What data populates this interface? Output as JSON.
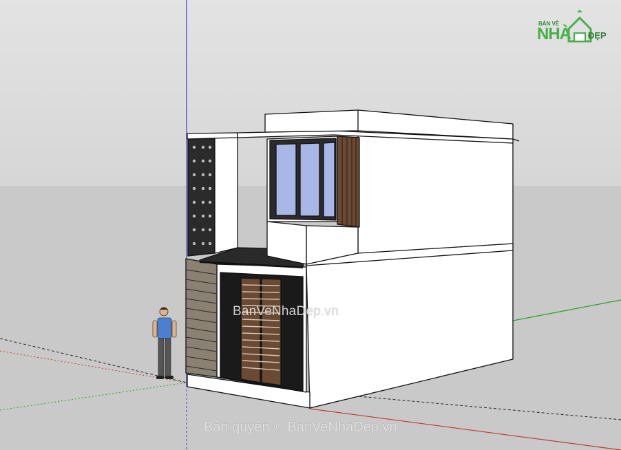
{
  "logo": {
    "small_text": "BẢN VẼ",
    "nha_text": "NHÀ",
    "dep_text": "ĐẸP"
  },
  "watermark": {
    "center_text": "BanVeNhaDep.vn",
    "copyright_text": "Bản quyền © BanVeNhaDep.vn"
  },
  "colors": {
    "sky": "#dedede",
    "ground": "#c9c9c9",
    "axis_blue": "#3b3bd6",
    "axis_green": "#1fa51f",
    "axis_red": "#c0392b",
    "wall": "#ffffff",
    "wood": "#6b4a33",
    "glass": "#a9b7e6",
    "logo_green": "#48b04a"
  }
}
